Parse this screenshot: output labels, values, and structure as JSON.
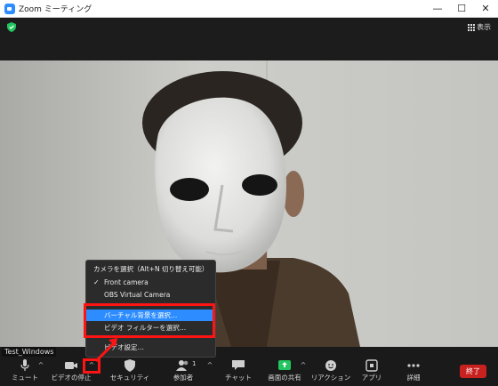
{
  "window": {
    "title": "Zoom ミーティング",
    "minimize": "—",
    "maximize": "☐",
    "close": "✕"
  },
  "top_bar": {
    "security_icon": "green-shield-icon",
    "view_label": "表示"
  },
  "participant": {
    "name": "Test_Windows"
  },
  "camera_menu": {
    "header": "カメラを選択（Alt+N 切り替え可能）",
    "items": [
      {
        "label": "Front camera",
        "checked": true
      },
      {
        "label": "OBS Virtual Camera",
        "checked": false
      },
      {
        "label": "バーチャル背景を選択…",
        "selected": true
      },
      {
        "label": "ビデオ フィルターを選択…",
        "selected": false
      },
      {
        "label": "ビデオ設定…"
      }
    ]
  },
  "toolbar": {
    "mute_label": "ミュート",
    "video_label": "ビデオの停止",
    "security_label": "セキュリティ",
    "participants_label": "参加者",
    "participants_count": "1",
    "chat_label": "チャット",
    "share_label": "画面の共有",
    "reactions_label": "リアクション",
    "apps_label": "アプリ",
    "more_label": "詳細",
    "end_label": "終了"
  },
  "colors": {
    "accent": "#2d8cff",
    "end_button": "#c8211f",
    "highlight": "#ff1414",
    "share_green": "#22c55e"
  }
}
